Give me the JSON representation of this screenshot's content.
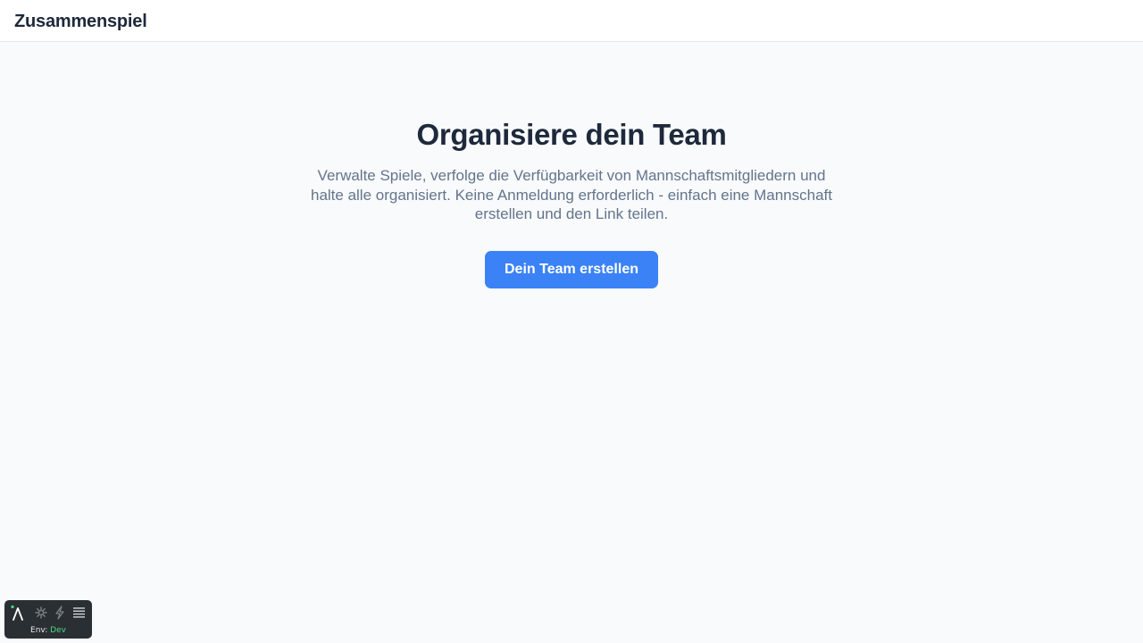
{
  "header": {
    "brand": "Zusammenspiel"
  },
  "hero": {
    "title": "Organisiere dein Team",
    "subtitle": "Verwalte Spiele, verfolge die Verfügbarkeit von Mannschaftsmitgliedern und halte alle organisiert. Keine Anmeldung erforderlich - einfach eine Mannschaft erstellen und den Link teilen.",
    "cta_label": "Dein Team erstellen"
  },
  "dev_toolbar": {
    "icons": [
      "lambda-icon",
      "settings-icon",
      "lightning-icon",
      "menu-icon"
    ],
    "env_label": "Env:",
    "env_value": "Dev"
  },
  "colors": {
    "background": "#f8fafc",
    "header_bg": "#ffffff",
    "text_primary": "#1e293b",
    "text_secondary": "#64748b",
    "accent": "#3b82f6",
    "toolbar_bg": "#2a2f33",
    "env_value": "#4ade80"
  }
}
